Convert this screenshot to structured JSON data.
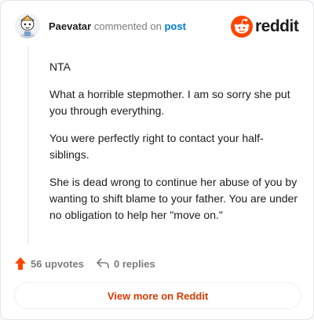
{
  "header": {
    "username": "Paevatar",
    "action": "commented on",
    "post_link": "post",
    "brand_name": "reddit"
  },
  "comment": {
    "paragraphs": [
      "NTA",
      "What a horrible stepmother. I am so sorry she put you through everything.",
      "You were perfectly right to contact your half-siblings.",
      "She is dead wrong to continue her abuse of you by wanting to shift blame to your father. You are under no obligation to help her \"move on.\""
    ]
  },
  "footer": {
    "upvotes": "56 upvotes",
    "replies": "0 replies"
  },
  "cta": {
    "label": "View more on Reddit"
  },
  "colors": {
    "brand": "#ff4500",
    "link": "#0079d3",
    "cta_text": "#d93a00",
    "upvote_arrow": "#ff4500"
  },
  "icons": [
    "avatar",
    "reddit-logo-icon",
    "upvote-icon",
    "reply-icon"
  ]
}
